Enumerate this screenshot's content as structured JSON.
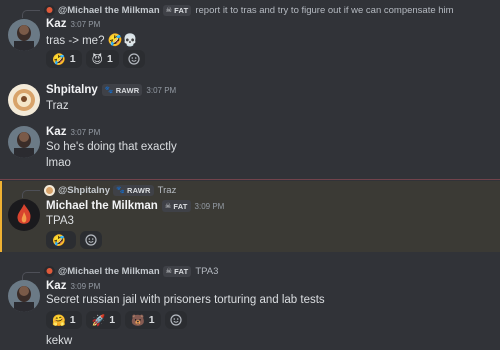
{
  "colors": {
    "background": "#313338",
    "highlight_bg": "#3b3a35",
    "highlight_border": "#f0b232",
    "reaction_bg": "#2b2d31"
  },
  "messages": [
    {
      "reply": {
        "name": "@Michael the Milkman",
        "tag": "FAT",
        "tag_icon": "skull-icon",
        "text": "report it to tras and try to figure out if we can compensate him"
      },
      "author": "Kaz",
      "time": "3:07 PM",
      "text": "tras -> me?",
      "text_emojis": [
        "🤣",
        "💀"
      ],
      "reactions": [
        {
          "emoji": "🤣",
          "count": "1"
        },
        {
          "emoji": "😈",
          "count": "1"
        }
      ]
    },
    {
      "author": "Shpitalny",
      "tag": "RAWR",
      "tag_icon": "paw-icon",
      "time": "3:07 PM",
      "text": "Traz"
    },
    {
      "author": "Kaz",
      "time": "3:07 PM",
      "text": "So he's doing that exactly",
      "text2": "lmao"
    },
    {
      "reply": {
        "name": "@Shpitalny",
        "tag": "RAWR",
        "tag_icon": "paw-icon",
        "text": "Traz"
      },
      "author": "Michael the Milkman",
      "tag": "FAT",
      "tag_icon": "skull-icon",
      "time": "3:09 PM",
      "text": "TPA3",
      "reactions": [
        {
          "emoji": "🤣",
          "count": ""
        }
      ]
    },
    {
      "reply": {
        "name": "@Michael the Milkman",
        "tag": "FAT",
        "tag_icon": "skull-icon",
        "text": "TPA3"
      },
      "author": "Kaz",
      "time": "3:09 PM",
      "text": "Secret russian jail with prisoners torturing and lab tests",
      "reactions": [
        {
          "emoji": "🤗",
          "count": "1"
        },
        {
          "emoji": "🚀",
          "count": "1"
        },
        {
          "emoji": "🐻",
          "count": "1"
        }
      ],
      "text2": "kekw"
    }
  ]
}
